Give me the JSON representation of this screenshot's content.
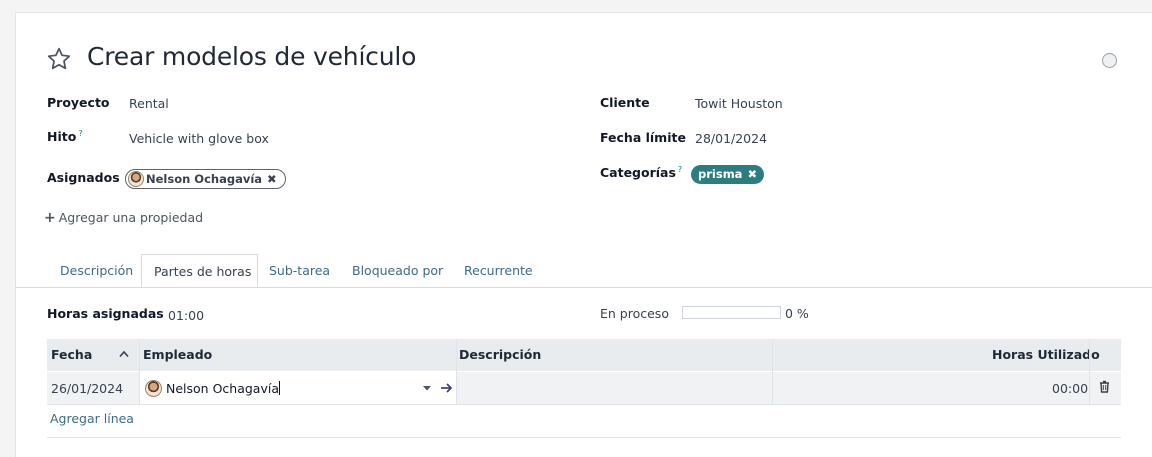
{
  "task": {
    "title": "Crear modelos de vehículo",
    "fields_left": {
      "project_label": "Proyecto",
      "project_value": "Rental",
      "milestone_label": "Hito",
      "milestone_help": "?",
      "milestone_value": "Vehicle with glove box",
      "assignees_label": "Asignados",
      "assignee_tag": "Nelson Ochagavía"
    },
    "fields_right": {
      "customer_label": "Cliente",
      "customer_value": "Towit Houston",
      "deadline_label": "Fecha límite",
      "deadline_value": "28/01/2024",
      "tags_label": "Categorías",
      "tags_help": "?",
      "tag": "prisma"
    },
    "add_property": "Agregar una propiedad",
    "remove_glyph": "✖",
    "add_glyph": "+"
  },
  "tabs": [
    {
      "label": "Descripción",
      "active": false
    },
    {
      "label": "Partes de horas",
      "active": true
    },
    {
      "label": "Sub-tarea",
      "active": false
    },
    {
      "label": "Bloqueado por",
      "active": false
    },
    {
      "label": "Recurrente",
      "active": false
    }
  ],
  "timesheets": {
    "allocated_label": "Horas asignadas",
    "allocated_value": "01:00",
    "progress_label": "En proceso",
    "progress_value": 0,
    "progress_text": "0 %",
    "columns": [
      "Fecha",
      "Empleado",
      "Descripción",
      "Horas Utilizado"
    ],
    "rows": [
      {
        "date": "26/01/2024",
        "employee": "Nelson Ochagavía",
        "description": "",
        "hours": "00:00"
      }
    ],
    "add_line": "Agregar línea"
  },
  "colors": {
    "accent": "#017e84",
    "tag_bg": "#2c7d82",
    "link": "#3d6b8a"
  },
  "icons": [
    "star-icon",
    "status-circle-icon",
    "sort-up-icon",
    "dropdown-caret-icon",
    "internal-link-arrow-icon",
    "trash-icon",
    "avatar"
  ]
}
